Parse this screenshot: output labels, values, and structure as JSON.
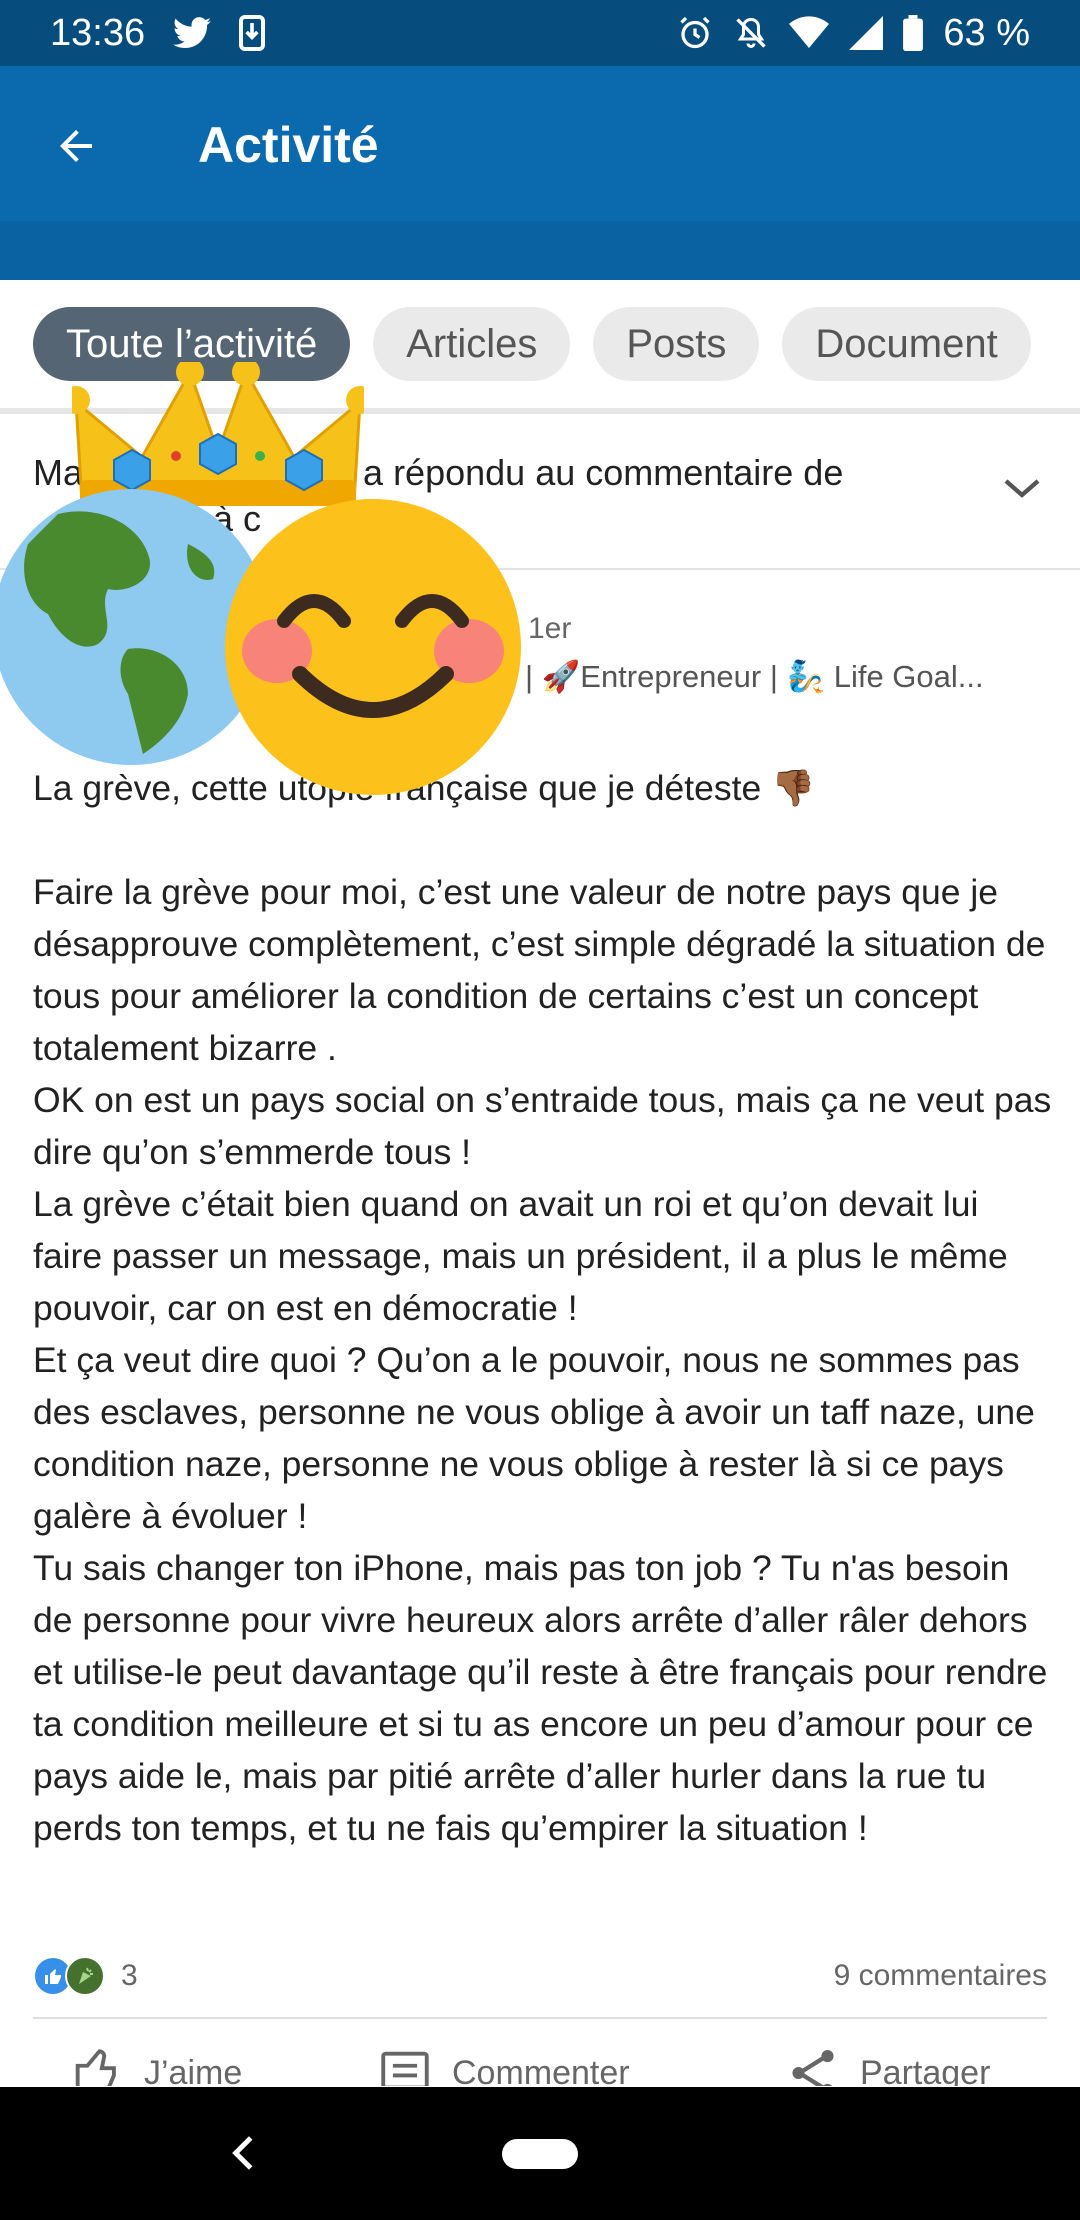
{
  "status_bar": {
    "time": "13:36",
    "battery": "63 %"
  },
  "app_bar": {
    "title": "Activité"
  },
  "filters": [
    {
      "label": "Toute l’activité",
      "active": true
    },
    {
      "label": "Articles",
      "active": false
    },
    {
      "label": "Posts",
      "active": false
    },
    {
      "label": "Document",
      "active": false
    }
  ],
  "activity": {
    "text_visible_start": "Ma",
    "text_visible_mid": "a répondu au commentaire de",
    "text_visible_line2": "n à c"
  },
  "post": {
    "degree": "1er",
    "headline": "| 🚀Entrepreneur | 🧞 Life Goal...",
    "lines": [
      "La grève, cette utopie française que je déteste 👎🏾",
      "",
      "Faire la grève pour moi, c’est une valeur de notre pays que je désapprouve complètement, c’est simple dégradé la situation de tous pour améliorer la condition de certains c’est un concept totalement bizarre .",
      "OK on est un pays social on s’entraide tous, mais ça ne veut pas dire qu’on s’emmerde tous !",
      "La grève c’était bien quand on avait un roi et qu’on devait lui faire passer un message, mais un président, il a plus le même pouvoir, car on est en démocratie !",
      "Et ça veut dire quoi ? Qu’on a le pouvoir, nous ne sommes pas des esclaves, personne ne vous oblige à avoir un taff naze, une condition naze, personne ne vous oblige à rester là si ce pays galère à évoluer !",
      "Tu sais changer ton iPhone, mais pas ton job ? Tu n'as besoin de personne pour vivre heureux alors arrête d’aller râler dehors et utilise-le peut davantage qu’il reste à être français pour rendre ta condition meilleure et si tu as encore un peu d’amour pour ce pays aide le, mais par pitié arrête d’aller hurler dans la rue tu perds ton temps, et tu ne fais qu’empirer la situation !"
    ],
    "reaction_count": "3",
    "comments": "9 commentaires"
  },
  "actions": {
    "like": "J’aime",
    "comment": "Commenter",
    "share": "Partager"
  },
  "colors": {
    "status_bar": "#064d7d",
    "app_bar": "#0b69ae",
    "chip_active": "#566573",
    "chip": "#eaeaea"
  },
  "icons": [
    "twitter-icon",
    "download-icon",
    "alarm-icon",
    "mute-icon",
    "wifi-icon",
    "signal-icon",
    "battery-icon",
    "back-arrow-icon",
    "chevron-down-icon",
    "like-icon",
    "comment-icon",
    "share-icon"
  ]
}
